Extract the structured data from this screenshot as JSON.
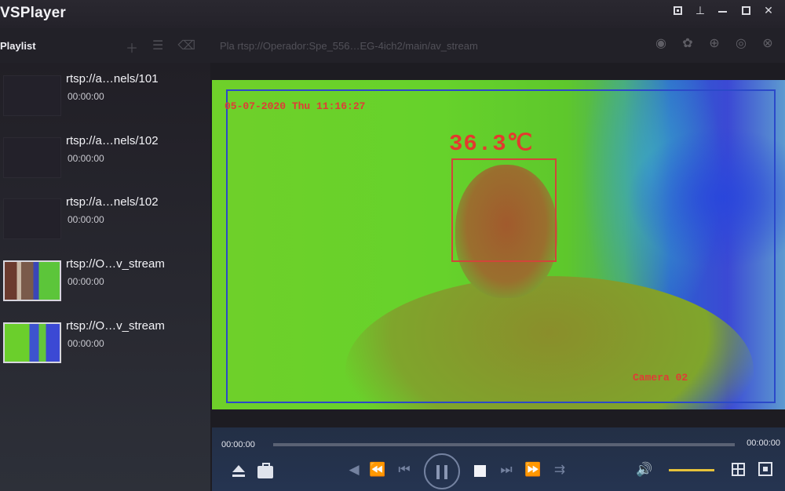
{
  "app": {
    "title": "VSPlayer"
  },
  "window_controls": [
    "mini-mode",
    "pin",
    "minimize",
    "maximize"
  ],
  "sidebar": {
    "heading": "Playlist",
    "items": [
      {
        "name": "rtsp://a…nels/101",
        "time": "00:00:00",
        "thumb": "blank"
      },
      {
        "name": "rtsp://a…nels/102",
        "time": "00:00:00",
        "thumb": "blank"
      },
      {
        "name": "rtsp://a…nels/102",
        "time": "00:00:00",
        "thumb": "blank"
      },
      {
        "name": "rtsp://O…v_stream",
        "time": "00:00:00",
        "thumb": "snapshot"
      },
      {
        "name": "rtsp://O…v_stream",
        "time": "00:00:00",
        "thumb": "thermal"
      }
    ]
  },
  "toolbar": {
    "url": "Pla rtsp://Operador:Spe_556…EG-4ich2/main/av_stream",
    "tools": [
      "add-icon",
      "list-icon",
      "delete-icon"
    ],
    "right_icons": [
      "mute-icon",
      "settings-icon",
      "zoom-icon",
      "snapshot-icon",
      "close-icon"
    ]
  },
  "video": {
    "osd_datetime": "05-07-2020 Thu 11:16:27",
    "temperature": "36.3℃",
    "camera_label": "Camera 02"
  },
  "controls": {
    "current_time": "00:00:00",
    "end_time": "00:00:00",
    "progress": 0,
    "volume": 0.8
  },
  "colors": {
    "accent_volume": "#e6c23a",
    "osd_red": "#e03b36",
    "frame_blue": "#2b49c9"
  }
}
